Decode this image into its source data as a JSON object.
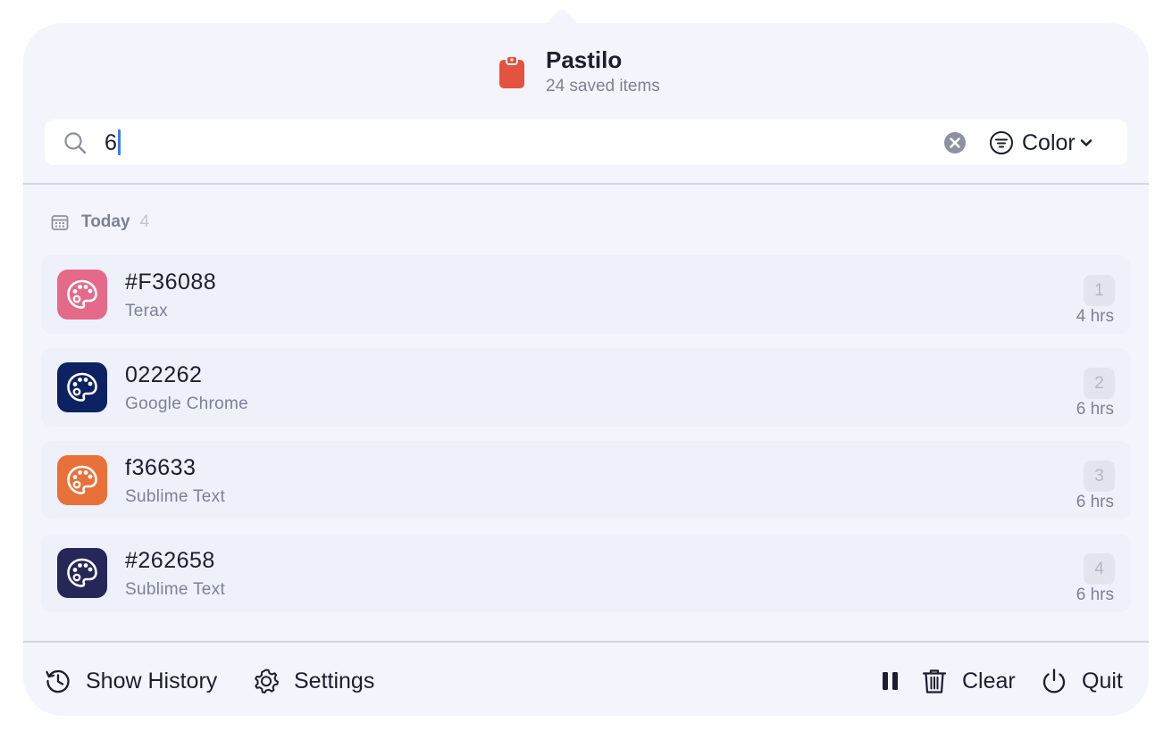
{
  "header": {
    "title": "Pastilo",
    "subtitle": "24 saved items"
  },
  "search": {
    "value": "6",
    "filter_label": "Color"
  },
  "section": {
    "title": "Today",
    "count": "4"
  },
  "items": [
    {
      "value": "#F36088",
      "source": "Terax",
      "index": "1",
      "time": "4 hrs",
      "color": "#e56a8a"
    },
    {
      "value": "022262",
      "source": "Google Chrome",
      "index": "2",
      "time": "6 hrs",
      "color": "#0d2262"
    },
    {
      "value": "f36633",
      "source": "Sublime Text",
      "index": "3",
      "time": "6 hrs",
      "color": "#e8713a"
    },
    {
      "value": "#262658",
      "source": "Sublime Text",
      "index": "4",
      "time": "6 hrs",
      "color": "#262658"
    }
  ],
  "footer": {
    "history_label": "Show History",
    "settings_label": "Settings",
    "clear_label": "Clear",
    "quit_label": "Quit"
  },
  "icons": {
    "app": "clipboard-icon",
    "search": "search-icon",
    "clear": "clear-search-icon",
    "filter": "filter-icon",
    "section": "calendar-icon",
    "item": "palette-icon",
    "history": "history-icon",
    "settings": "gear-icon",
    "pause": "pause-icon",
    "trash": "trash-icon",
    "quit": "power-icon"
  },
  "colors": {
    "accent": "#3f78f4",
    "brand": "#e4533f"
  }
}
